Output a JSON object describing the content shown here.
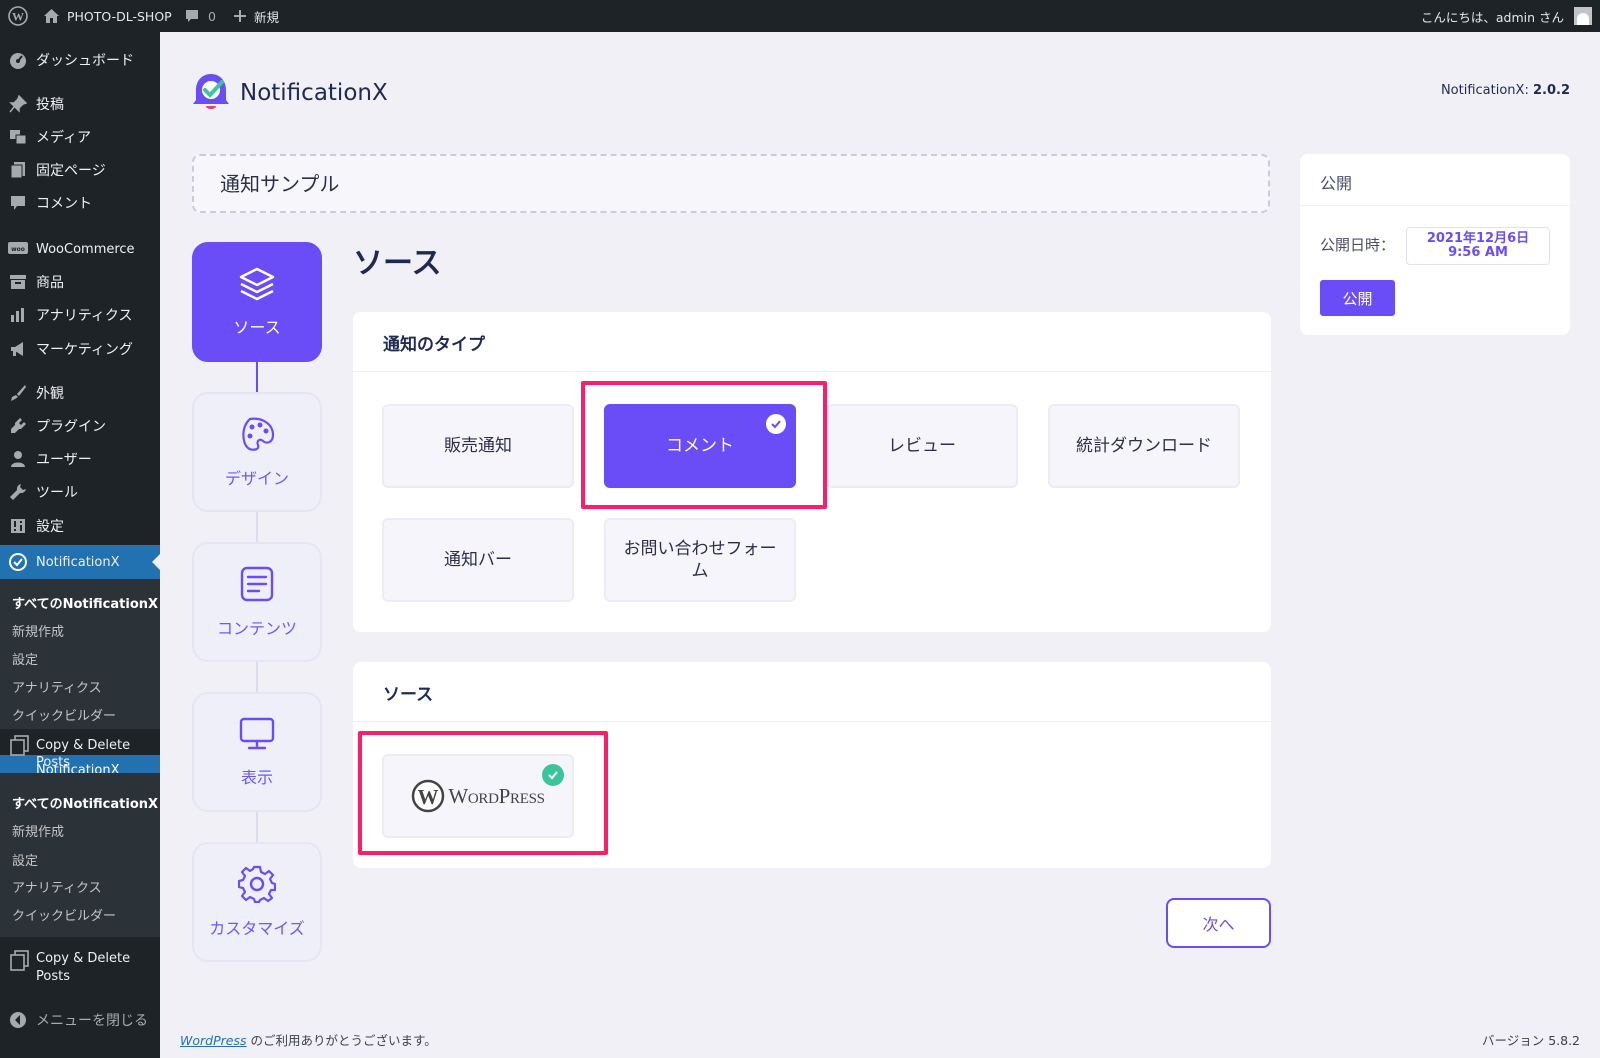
{
  "adminbar": {
    "site_name": "PHOTO-DL-SHOP",
    "comments_count": "0",
    "new_label": "新規",
    "greeting": "こんにちは、admin さん"
  },
  "sidebar": {
    "items": [
      {
        "label": "ダッシュボード",
        "icon": "dashboard-icon"
      },
      {
        "label": "投稿",
        "icon": "pin-icon"
      },
      {
        "label": "メディア",
        "icon": "media-icon"
      },
      {
        "label": "固定ページ",
        "icon": "page-icon"
      },
      {
        "label": "コメント",
        "icon": "comment-icon"
      },
      {
        "label": "WooCommerce",
        "icon": "woo-icon"
      },
      {
        "label": "商品",
        "icon": "archive-icon"
      },
      {
        "label": "アナリティクス",
        "icon": "chart-icon"
      },
      {
        "label": "マーケティング",
        "icon": "megaphone-icon"
      },
      {
        "label": "外観",
        "icon": "brush-icon"
      },
      {
        "label": "プラグイン",
        "icon": "plugin-icon"
      },
      {
        "label": "ユーザー",
        "icon": "user-icon"
      },
      {
        "label": "ツール",
        "icon": "wrench-icon"
      },
      {
        "label": "設定",
        "icon": "settings-icon"
      },
      {
        "label": "NotificationX",
        "icon": "notificationx-icon"
      }
    ],
    "submenu": [
      "すべてのNotificationX",
      "新規作成",
      "設定",
      "アナリティクス",
      "クイックビルダー"
    ],
    "copy_delete": "Copy & Delete Posts",
    "copy_delete_l1": "Copy & Delete",
    "copy_delete_l2": "Posts",
    "overlap_label": "NotificationX",
    "collapse": "メニューを閉じる"
  },
  "header": {
    "brand": "NotificationX",
    "version_label": "NotificationX:",
    "version_value": "2.0.2"
  },
  "title_input": "通知サンプル",
  "steps": [
    {
      "label": "ソース",
      "icon": "layers-icon",
      "active": true
    },
    {
      "label": "デザイン",
      "icon": "palette-icon",
      "active": false
    },
    {
      "label": "コンテンツ",
      "icon": "document-icon",
      "active": false
    },
    {
      "label": "表示",
      "icon": "monitor-icon",
      "active": false
    },
    {
      "label": "カスタマイズ",
      "icon": "gear-icon",
      "active": false
    }
  ],
  "section_heading": "ソース",
  "type_panel": {
    "title": "通知のタイプ",
    "options": [
      "販売通知",
      "コメント",
      "レビュー",
      "統計ダウンロード",
      "通知バー",
      "お問い合わせフォーム"
    ],
    "selected": "コメント"
  },
  "source_panel": {
    "title": "ソース",
    "option": "WordPress",
    "logo_text": "WordPress"
  },
  "publish": {
    "title": "公開",
    "date_label": "公開日時：",
    "date_line1": "2021年12月6日",
    "date_line2": "9:56 AM",
    "button": "公開"
  },
  "next_button": "次へ",
  "footer": {
    "link": "WordPress",
    "thanks": " のご利用ありがとうございます。",
    "version": "バージョン 5.8.2"
  },
  "colors": {
    "accent": "#6a4df7",
    "highlight": "#ff1d6a",
    "check_green": "#3cc59a",
    "wp_blue": "#2271b1"
  }
}
